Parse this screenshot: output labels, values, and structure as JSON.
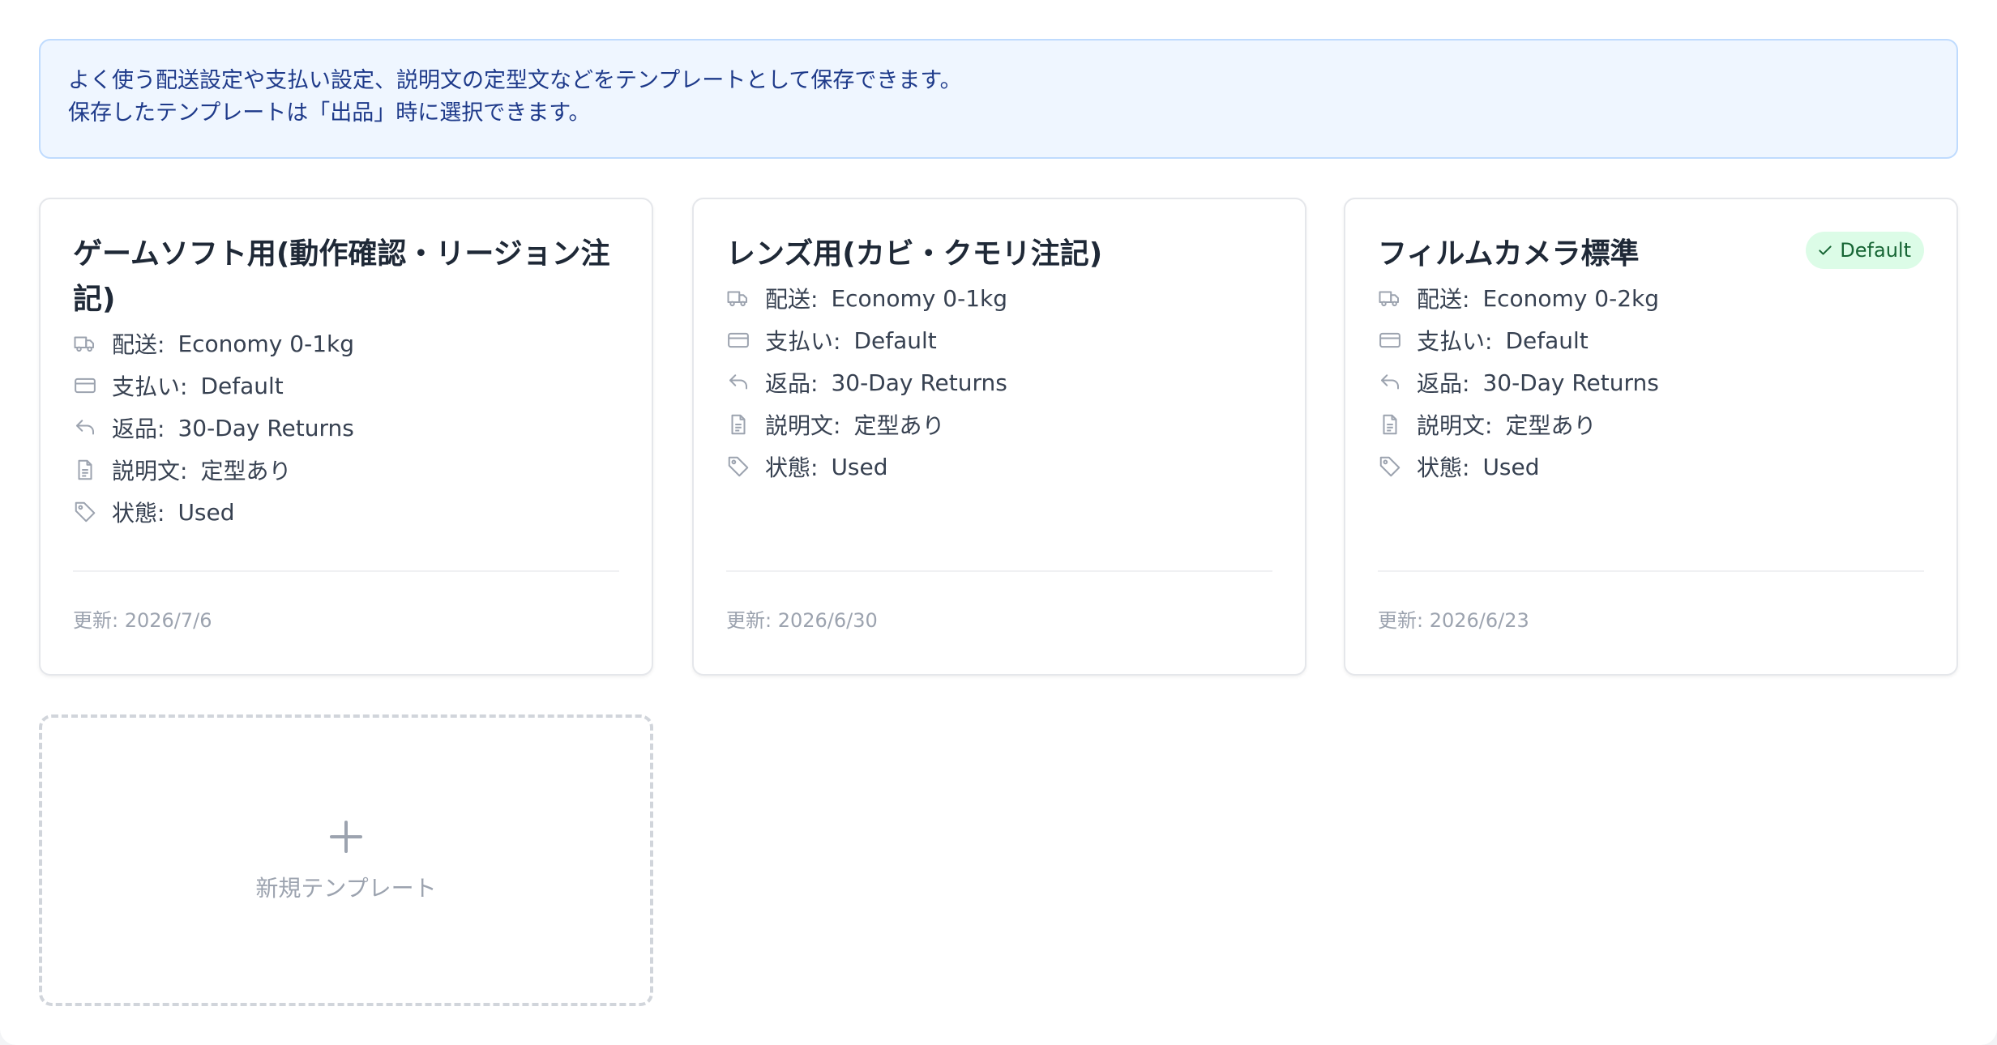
{
  "notice": {
    "line1": "よく使う配送設定や支払い設定、説明文の定型文などをテンプレートとして保存できます。",
    "line2": "保存したテンプレートは「出品」時に選択できます。"
  },
  "labels": {
    "shipping": "配送:",
    "payment": "支払い:",
    "returns": "返品:",
    "description": "説明文:",
    "condition": "状態:"
  },
  "templates": [
    {
      "title": "ゲームソフト用(動作確認・リージョン注記)",
      "shipping": "Economy 0-1kg",
      "payment": "Default",
      "returns": "30-Day Returns",
      "description": "定型あり",
      "condition": "Used",
      "updated": "更新: 2026/7/6"
    },
    {
      "title": "レンズ用(カビ・クモリ注記)",
      "shipping": "Economy 0-1kg",
      "payment": "Default",
      "returns": "30-Day Returns",
      "description": "定型あり",
      "condition": "Used",
      "updated": "更新: 2026/6/30"
    },
    {
      "title": "フィルムカメラ標準",
      "badge": "Default",
      "shipping": "Economy 0-2kg",
      "payment": "Default",
      "returns": "30-Day Returns",
      "description": "定型あり",
      "condition": "Used",
      "updated": "更新: 2026/6/23"
    }
  ],
  "new_template": {
    "label": "新規テンプレート"
  },
  "colors": {
    "notice_bg": "#eff6ff",
    "notice_text": "#1e3a8a",
    "badge_bg": "#dcfce7",
    "badge_text": "#166534"
  },
  "icons": {
    "shipping": "truck-icon",
    "payment": "credit-card-icon",
    "returns": "return-arrow-icon",
    "description": "document-icon",
    "condition": "tag-icon",
    "badge": "check-icon",
    "new": "plus-icon"
  }
}
